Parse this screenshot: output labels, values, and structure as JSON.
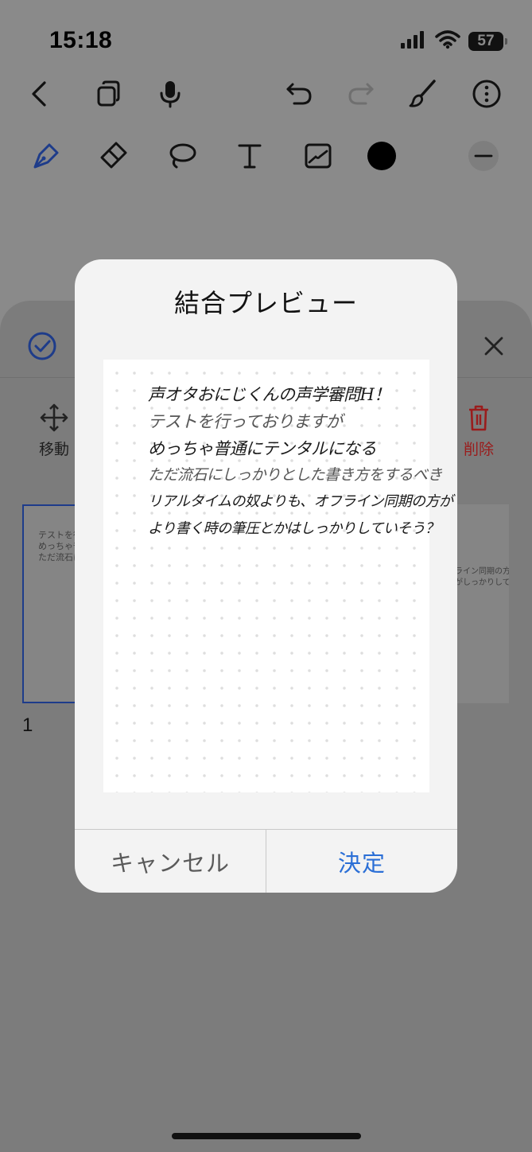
{
  "status": {
    "time": "15:18",
    "battery": "57",
    "icons": [
      "signal-icon",
      "wifi-icon",
      "battery-icon"
    ]
  },
  "toolbar": {
    "top_icons": [
      "back-icon",
      "pages-icon",
      "microphone-icon",
      "undo-icon",
      "redo-icon",
      "brush-icon",
      "more-icon"
    ],
    "tool_icons": [
      "pen-icon",
      "eraser-icon",
      "lasso-icon",
      "text-icon",
      "image-icon",
      "color-swatch",
      "minus-icon"
    ],
    "active_color": "#000000"
  },
  "sheet": {
    "move_label": "移動",
    "delete_label": "削除",
    "page_number": "1",
    "thumb_left_text": [
      "テストを行",
      "めっちゃ普",
      "ただ流石に"
    ],
    "thumb_right_text": [
      "ライン同期の方が",
      "がしっかりしていそう？"
    ]
  },
  "dialog": {
    "title": "結合プレビュー",
    "cancel_label": "キャンセル",
    "confirm_label": "決定",
    "handwriting": [
      "声オタおにじくんの声学審問H！",
      "テストを行っておりますが",
      "めっちゃ普通にテンタルになる",
      "ただ流石にしっかりとした書き方をするべき",
      "リアルタイムの奴よりも、オフライン同期の方が",
      "より書く時の筆圧とかはしっかりしていそう？"
    ]
  },
  "colors": {
    "accent": "#2b6fd6",
    "delete": "#9a1c1c",
    "overlay": "#8a8a8a"
  }
}
